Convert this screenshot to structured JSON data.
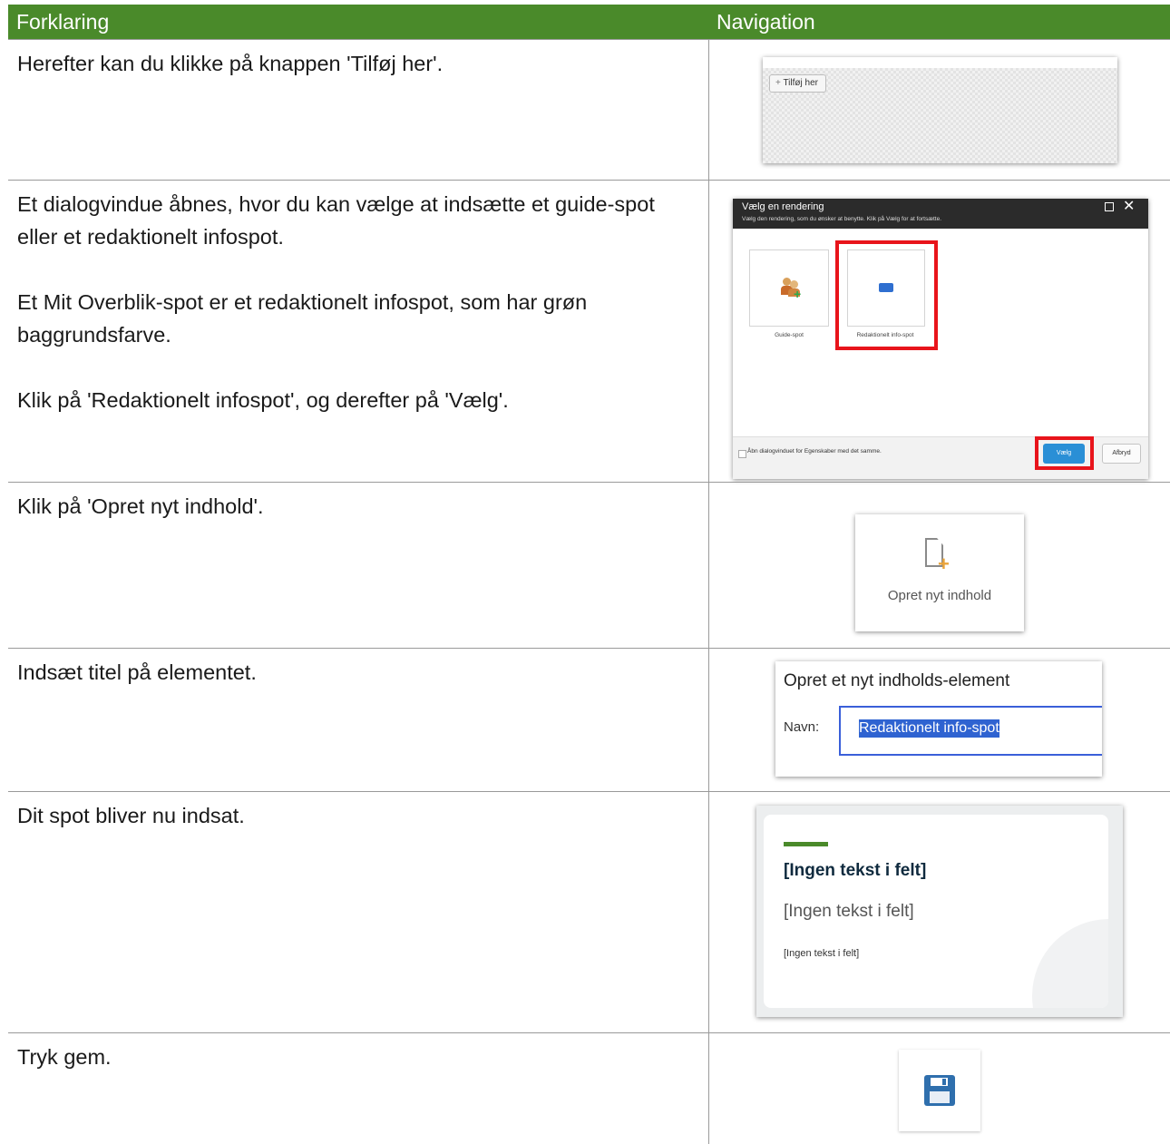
{
  "table": {
    "header": {
      "left": "Forklaring",
      "right": "Navigation"
    },
    "rows": [
      {
        "text": [
          "Herefter kan du klikke på knappen 'Tilføj her'."
        ]
      },
      {
        "text": [
          "Et dialogvindue åbnes, hvor du kan vælge at indsætte et guide-spot eller et redaktionelt infospot.",
          "Et Mit Overblik-spot er et redaktionelt infospot, som har grøn baggrundsfarve.",
          "Klik på 'Redaktionelt infospot', og derefter på 'Vælg'."
        ]
      },
      {
        "text": [
          "Klik på 'Opret nyt indhold'."
        ]
      },
      {
        "text": [
          "Indsæt titel på elementet."
        ]
      },
      {
        "text": [
          "Dit spot bliver nu indsat."
        ]
      },
      {
        "text": [
          "Tryk gem."
        ]
      }
    ]
  },
  "shot1": {
    "button_label": "Tilføj her"
  },
  "shot2": {
    "title": "Vælg en rendering",
    "subtitle": "Vælg den rendering, som du ønsker at benytte. Klik på Vælg for at fortsætte.",
    "options": [
      "Guide-spot",
      "Redaktionelt info-spot"
    ],
    "checkbox_label": "Åbn dialogvinduet for Egenskaber med det samme.",
    "ok_label": "Vælg",
    "cancel_label": "Afbryd"
  },
  "shot3": {
    "label": "Opret nyt indhold"
  },
  "shot4": {
    "title": "Opret et nyt indholds-element",
    "field_label": "Navn:",
    "field_value": "Redaktionelt info-spot"
  },
  "shot5": {
    "heading": "[Ingen tekst i felt]",
    "subheading": "[Ingen tekst i felt]",
    "body": "[Ingen tekst i felt]"
  },
  "colors": {
    "header_green": "#4a8a2a",
    "highlight_red": "#e8141b",
    "dialog_dark": "#2b2b2b",
    "save_blue": "#2f6fad"
  }
}
